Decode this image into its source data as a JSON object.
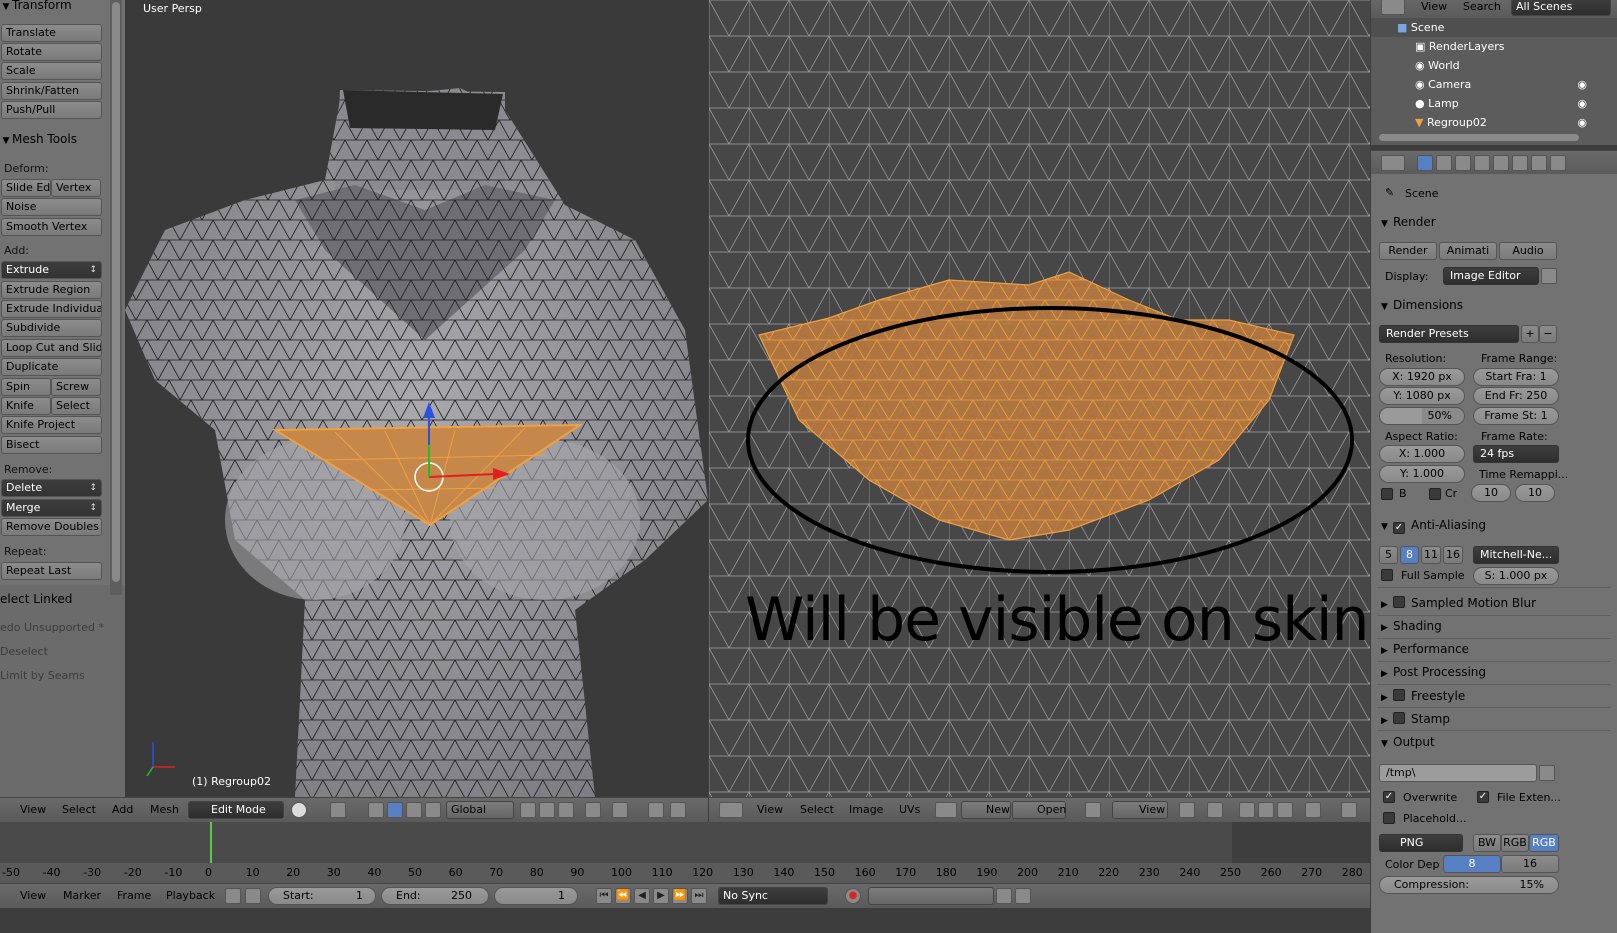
{
  "toolshelf": {
    "transform_header": "Transform",
    "transform_buttons": [
      "Translate",
      "Rotate",
      "Scale",
      "Shrink/Fatten",
      "Push/Pull"
    ],
    "mesh_tools_header": "Mesh Tools",
    "deform_label": "Deform:",
    "slide_edge": "Slide Ed",
    "vertex": "Vertex",
    "noise": "Noise",
    "smooth_vertex": "Smooth Vertex",
    "add_label": "Add:",
    "extrude": "Extrude",
    "extrude_region": "Extrude Region",
    "extrude_individual": "Extrude Individual",
    "subdivide": "Subdivide",
    "loop_cut": "Loop Cut and Slide",
    "duplicate": "Duplicate",
    "spin": "Spin",
    "screw": "Screw",
    "knife": "Knife",
    "select": "Select",
    "knife_project": "Knife Project",
    "bisect": "Bisect",
    "remove_label": "Remove:",
    "delete": "Delete",
    "merge": "Merge",
    "remove_doubles": "Remove Doubles",
    "repeat_label": "Repeat:",
    "repeat_last": "Repeat Last",
    "last_op": "elect Linked",
    "undo_unsupported": "edo Unsupported *",
    "deselect": "Deselect",
    "limit_by_seams": "Limit by Seams"
  },
  "viewport3d": {
    "title": "User Persp",
    "object_label": "(1) Regroup02",
    "header": {
      "menus": [
        "View",
        "Select",
        "Add",
        "Mesh"
      ],
      "mode": "Edit Mode",
      "orientation": "Global"
    }
  },
  "image_editor": {
    "annotation": "Will be visible on skin",
    "header": {
      "menus": [
        "View",
        "Select",
        "Image",
        "UVs"
      ],
      "new": "New",
      "open": "Open",
      "view": "View"
    }
  },
  "timeline": {
    "ticks": [
      "-50",
      "-40",
      "-30",
      "-20",
      "-10",
      "0",
      "10",
      "20",
      "30",
      "40",
      "50",
      "60",
      "70",
      "80",
      "90",
      "100",
      "110",
      "120",
      "130",
      "140",
      "150",
      "160",
      "170",
      "180",
      "190",
      "200",
      "210",
      "220",
      "230",
      "240",
      "250",
      "260",
      "270",
      "280"
    ],
    "header": {
      "menus": [
        "View",
        "Marker",
        "Frame",
        "Playback"
      ],
      "start_label": "Start:",
      "start_value": "1",
      "end_label": "End:",
      "end_value": "250",
      "current": "1",
      "sync": "No Sync"
    }
  },
  "outliner": {
    "menus": [
      "View",
      "Search"
    ],
    "filter": "All Scenes",
    "items": [
      "Scene",
      "RenderLayers",
      "World",
      "Camera",
      "Lamp",
      "Regroup02"
    ]
  },
  "properties": {
    "context": "Scene",
    "render_header": "Render",
    "render_btn": "Render",
    "anim_btn": "Animati",
    "audio_btn": "Audio",
    "display_label": "Display:",
    "display_value": "Image Editor",
    "dimensions_header": "Dimensions",
    "render_presets": "Render Presets",
    "resolution_label": "Resolution:",
    "res_x": "X: 1920 px",
    "res_y": "Y: 1080 px",
    "res_pct": "50%",
    "frame_range_label": "Frame Range:",
    "start_frame": "Start Fra: 1",
    "end_frame": "End Fr: 250",
    "frame_step": "Frame St: 1",
    "aspect_label": "Aspect Ratio:",
    "aspect_x": "X:     1.000",
    "aspect_y": "Y:     1.000",
    "frame_rate_label": "Frame Rate:",
    "fps": "24 fps",
    "time_remap_label": "Time Remappi...",
    "border_b": "B",
    "crop_cr": "Cr",
    "remap_old": "10",
    "remap_new": "10",
    "aa_header": "Anti-Aliasing",
    "aa_samples": [
      "5",
      "8",
      "11",
      "16"
    ],
    "aa_filter": "Mitchell-Ne...",
    "full_sample": "Full Sample",
    "filter_size": "S: 1.000 px",
    "collapsed": [
      "Sampled Motion Blur",
      "Shading",
      "Performance",
      "Post Processing",
      "Freestyle",
      "Stamp"
    ],
    "output_header": "Output",
    "output_path": "/tmp\\",
    "overwrite": "Overwrite",
    "file_ext": "File Exten...",
    "placeholders": "Placehold...",
    "format": "PNG",
    "color_modes": [
      "BW",
      "RGB",
      "RGB"
    ],
    "color_depth_label": "Color Dep",
    "depth_8": "8",
    "depth_16": "16",
    "compression": "Compression:",
    "compression_value": "15%"
  },
  "colors": {
    "selection_orange": "#f0a040",
    "selected_face": "#b97a3f",
    "accent_blue": "#5680c2"
  }
}
